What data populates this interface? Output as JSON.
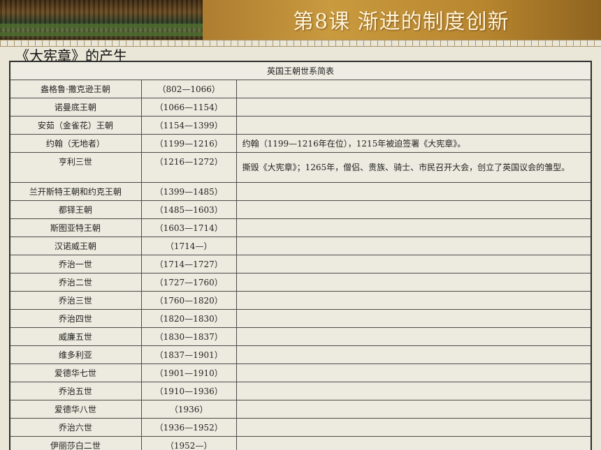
{
  "header": {
    "title": "第8课  渐进的制度创新"
  },
  "subtitle": "《大宪章》的产生",
  "table": {
    "title": "英国王朝世系简表",
    "rows": [
      {
        "name": "盎格鲁·撒克逊王朝",
        "period": "（802—1066）",
        "note": ""
      },
      {
        "name": "诺曼底王朝",
        "period": "（1066—1154）",
        "note": ""
      },
      {
        "name": "安茹（金雀花）王朝",
        "period": "（1154—1399）",
        "note": ""
      },
      {
        "name": "约翰（无地者）",
        "period": "（1199—1216）",
        "note": "约翰（1199—1216年在位），1215年被迫签署《大宪章》。"
      },
      {
        "name": "亨利三世",
        "period": "（1216—1272）",
        "note": "撕毁《大宪章》；1265年，僧侣、贵族、骑士、市民召开大会，创立了英国议会的雏型。"
      },
      {
        "name": "兰开斯特王朝和约克王朝",
        "period": "（1399—1485）",
        "note": ""
      },
      {
        "name": "都铎王朝",
        "period": "（1485—1603）",
        "note": ""
      },
      {
        "name": "斯图亚特王朝",
        "period": "（1603—1714）",
        "note": ""
      },
      {
        "name": "汉诺威王朝",
        "period": "（1714—）",
        "note": ""
      },
      {
        "name": "乔治一世",
        "period": "（1714—1727）",
        "note": ""
      },
      {
        "name": "乔治二世",
        "period": "（1727—1760）",
        "note": ""
      },
      {
        "name": "乔治三世",
        "period": "（1760—1820）",
        "note": ""
      },
      {
        "name": "乔治四世",
        "period": "（1820—1830）",
        "note": ""
      },
      {
        "name": "威廉五世",
        "period": "（1830—1837）",
        "note": ""
      },
      {
        "name": "维多利亚",
        "period": "（1837—1901）",
        "note": ""
      },
      {
        "name": "爱德华七世",
        "period": "（1901—1910）",
        "note": ""
      },
      {
        "name": "乔治五世",
        "period": "（1910—1936）",
        "note": ""
      },
      {
        "name": "爱德华八世",
        "period": "（1936）",
        "note": ""
      },
      {
        "name": "乔治六世",
        "period": "（1936—1952）",
        "note": ""
      },
      {
        "name": "伊丽莎白二世",
        "period": "（1952—）",
        "note": ""
      }
    ]
  }
}
